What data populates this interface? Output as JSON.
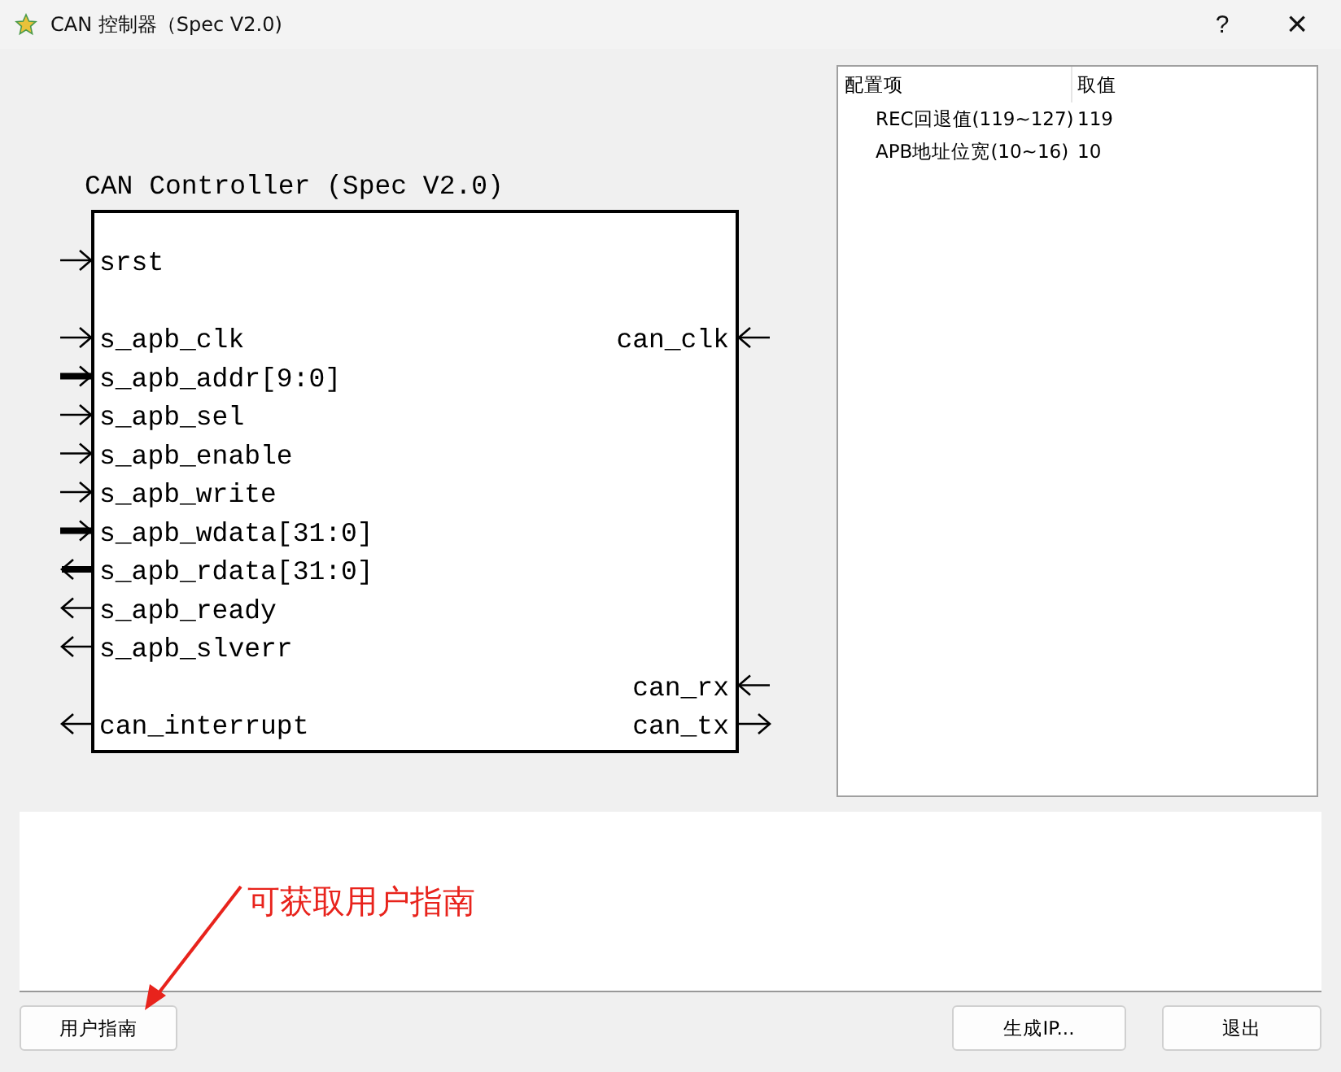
{
  "window": {
    "title": "CAN 控制器（Spec V2.0)",
    "help": "?",
    "close": "×"
  },
  "diagram": {
    "title": "CAN Controller (Spec V2.0)",
    "rows": [
      {
        "left": {
          "name": "srst",
          "output": false,
          "bus": false
        }
      },
      {},
      {
        "left": {
          "name": "s_apb_clk",
          "output": false,
          "bus": false
        },
        "right": {
          "name": "can_clk",
          "output": false,
          "bus": false
        }
      },
      {
        "left": {
          "name": "s_apb_addr[9:0]",
          "output": false,
          "bus": true
        }
      },
      {
        "left": {
          "name": "s_apb_sel",
          "output": false,
          "bus": false
        }
      },
      {
        "left": {
          "name": "s_apb_enable",
          "output": false,
          "bus": false
        }
      },
      {
        "left": {
          "name": "s_apb_write",
          "output": false,
          "bus": false
        }
      },
      {
        "left": {
          "name": "s_apb_wdata[31:0]",
          "output": false,
          "bus": true
        }
      },
      {
        "left": {
          "name": "s_apb_rdata[31:0]",
          "output": true,
          "bus": true
        }
      },
      {
        "left": {
          "name": "s_apb_ready",
          "output": true,
          "bus": false
        }
      },
      {
        "left": {
          "name": "s_apb_slverr",
          "output": true,
          "bus": false
        }
      },
      {
        "right": {
          "name": "can_rx",
          "output": false,
          "bus": false
        }
      },
      {
        "left": {
          "name": "can_interrupt",
          "output": true,
          "bus": false
        },
        "right": {
          "name": "can_tx",
          "output": true,
          "bus": false
        }
      }
    ]
  },
  "config_table": {
    "columns": [
      "配置项",
      "取值"
    ],
    "rows": [
      {
        "item": "REC回退值(119~127)",
        "value": "119"
      },
      {
        "item": "APB地址位宽(10~16)",
        "value": "10"
      }
    ]
  },
  "annotation": {
    "text": "可获取用户指南"
  },
  "buttons": {
    "guide": "用户指南",
    "generate": "生成IP...",
    "exit": "退出"
  }
}
